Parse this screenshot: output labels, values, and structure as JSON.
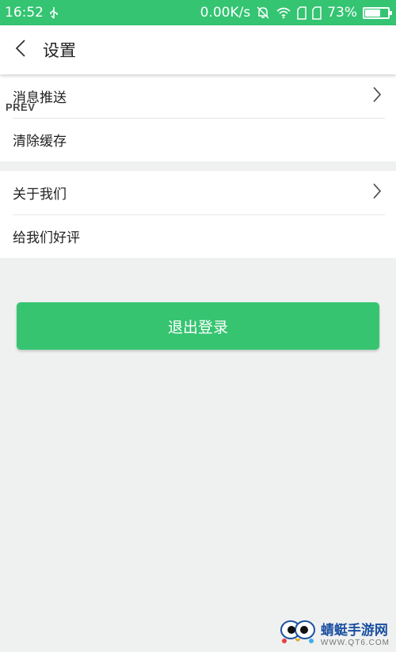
{
  "status_bar": {
    "time": "16:52",
    "network_speed": "0.00K/s",
    "battery_percent": "73%",
    "battery_level": 0.73,
    "icons": [
      "usb-icon",
      "mute-bell-icon",
      "wifi-icon",
      "sim-card-icon",
      "sim-card-icon"
    ],
    "bg_color": "#34c472"
  },
  "header": {
    "title": "设置",
    "back_icon": "chevron-left-icon"
  },
  "overlay": {
    "prev_label": "PREV"
  },
  "settings_groups": [
    {
      "items": [
        {
          "label": "消息推送",
          "has_chevron": true
        },
        {
          "label": "清除缓存",
          "has_chevron": false
        }
      ]
    },
    {
      "items": [
        {
          "label": "关于我们",
          "has_chevron": true
        },
        {
          "label": "给我们好评",
          "has_chevron": false
        }
      ]
    }
  ],
  "logout_button": {
    "label": "退出登录",
    "color": "#37c471"
  },
  "watermark": {
    "title": "蜻蜓手游网",
    "url": "WWW.QT6.COM"
  }
}
